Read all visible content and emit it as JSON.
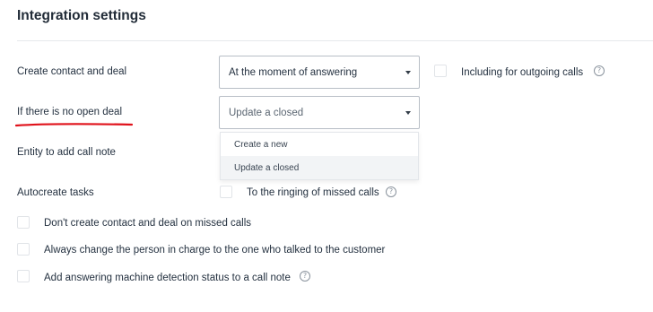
{
  "header": {
    "title": "Integration settings"
  },
  "rows": {
    "create_contact": {
      "label": "Create contact and deal",
      "select_value": "At the moment of answering",
      "checkbox_label": "Including for outgoing calls"
    },
    "no_open_deal": {
      "label": "If there is no open deal",
      "select_value": "Update a closed",
      "options": [
        "Create a new",
        "Update a closed"
      ]
    },
    "call_note": {
      "label": "Entity to add call note"
    },
    "autocreate": {
      "label": "Autocreate tasks",
      "checkbox_label": "To the ringing of missed calls"
    }
  },
  "checkboxes": [
    "Don't create contact and deal on missed calls",
    "Always change the person in charge to the one who talked to the customer",
    "Add answering machine detection status to a call note"
  ],
  "icons": {
    "help": "?"
  },
  "colors": {
    "annotation_red": "#e0121b"
  }
}
